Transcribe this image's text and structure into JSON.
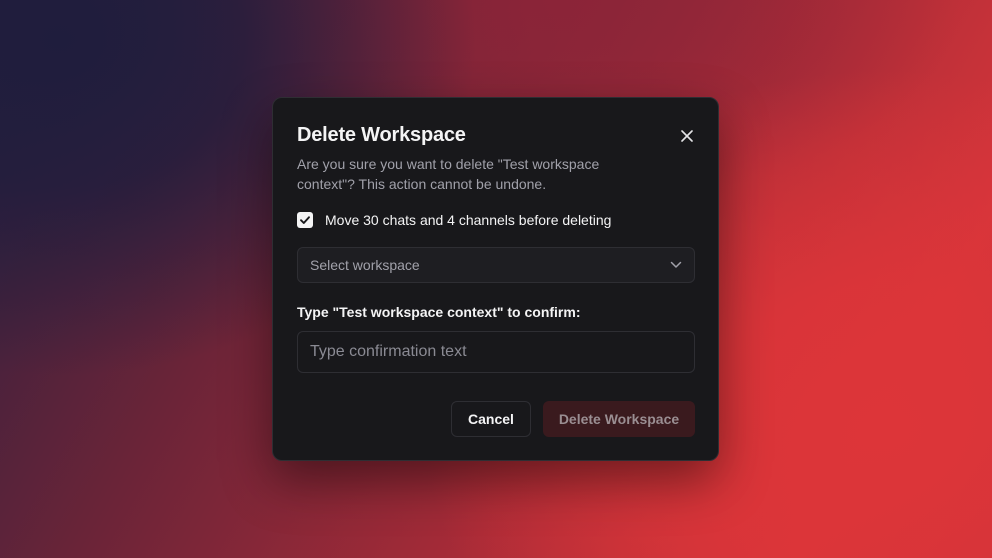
{
  "dialog": {
    "title": "Delete Workspace",
    "description": "Are you sure you want to delete \"Test workspace context\"? This action cannot be undone.",
    "close_icon": "close-icon",
    "move_option": {
      "checked": true,
      "label": "Move 30 chats and 4 channels before deleting"
    },
    "workspace_select": {
      "placeholder": "Select workspace",
      "icon": "chevron-down-icon"
    },
    "confirm": {
      "prefix": "Type ",
      "workspace_name": "\"Test workspace context\"",
      "suffix": " to confirm:",
      "input_value": "",
      "input_placeholder": "Type confirmation text"
    },
    "buttons": {
      "cancel_label": "Cancel",
      "delete_label": "Delete Workspace",
      "delete_enabled": false
    }
  },
  "colors": {
    "dialog_bg": "#18181b",
    "border": "#2e2e33",
    "text_primary": "#f4f4f5",
    "text_muted": "#a1a1aa",
    "danger_disabled_bg": "#3a1a1e"
  }
}
